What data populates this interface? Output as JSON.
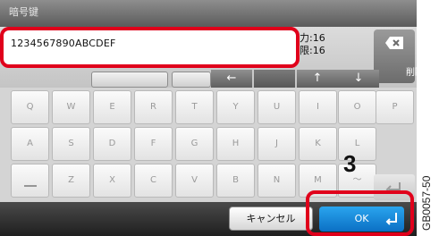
{
  "title": "暗号键",
  "entry": {
    "value": "1234567890ABCDEF"
  },
  "counts": {
    "line1": "力:16",
    "line2": "限:16"
  },
  "delete_label": "削除",
  "row2": {
    "label": "",
    "btn1": "",
    "btn2": ""
  },
  "arrows": {
    "left": "←",
    "up": "↑",
    "down": "↓"
  },
  "keyboard": {
    "row1": [
      "Q",
      "W",
      "E",
      "R",
      "T",
      "Y",
      "U",
      "I",
      "O",
      "P"
    ],
    "row2": [
      "A",
      "S",
      "D",
      "F",
      "G",
      "H",
      "J",
      "K",
      "L"
    ],
    "row3": [
      "",
      "Z",
      "X",
      "C",
      "V",
      "B",
      "N",
      "M",
      "〜"
    ]
  },
  "bottom": {
    "cancel": "キャンセル",
    "ok": "OK"
  },
  "annotation": {
    "step": "3",
    "code": "GB0057-50"
  },
  "colors": {
    "highlight": "#e0001b",
    "ok_blue": "#1a8ee0"
  }
}
